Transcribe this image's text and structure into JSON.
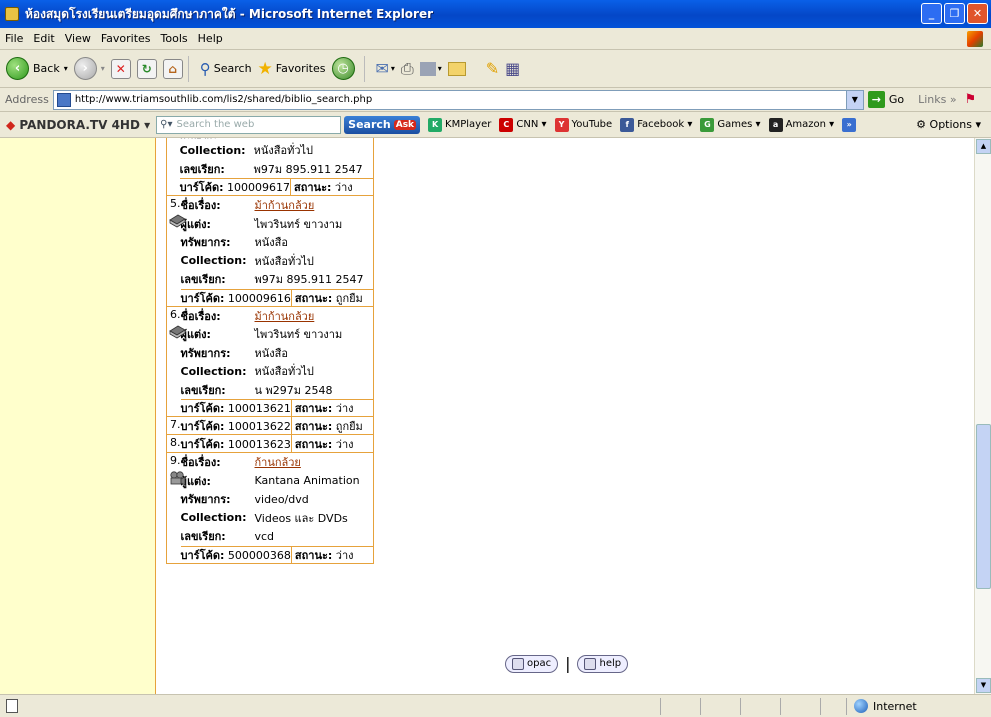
{
  "window": {
    "title": "ห้องสมุดโรงเรียนเตรียมอุดมศึกษาภาคใต้ - Microsoft Internet Explorer",
    "buttons": [
      "_",
      "❐",
      "✕"
    ]
  },
  "menu": [
    "File",
    "Edit",
    "View",
    "Favorites",
    "Tools",
    "Help"
  ],
  "toolbar": {
    "back": "Back",
    "search": "Search",
    "favorites": "Favorites"
  },
  "address": {
    "label": "Address",
    "url": "http://www.triamsouthlib.com/lis2/shared/biblio_search.php",
    "go": "Go",
    "links": "Links »"
  },
  "pandora": {
    "brand": "PANDORA.TV",
    "brand_suffix": "4HD",
    "search_placeholder": "Search the web",
    "search_btn": "Search",
    "bookmarks": [
      "KMPlayer",
      "CNN ▾",
      "YouTube",
      "Facebook ▾",
      "Games ▾",
      "Amazon ▾"
    ],
    "options": "Options ▾"
  },
  "results": {
    "top_partial": {
      "collection_label": "Collection:",
      "collection": "หนังสือทั่วไป",
      "call_label": "เลขเรียก:",
      "call": "พ97ม 895.911 2547",
      "barcode_label": "บาร์โค้ด:",
      "barcode": "100009617",
      "status_label": "สถานะ:",
      "status": "ว่าง"
    },
    "items": [
      {
        "num": "5.",
        "title_label": "ชื่อเรื่อง:",
        "title": "ม้าก้านกล้วย",
        "author_label": "ผู้แต่ง:",
        "author": "ไพวรินทร์ ขาวงาม",
        "type_label": "ทรัพยากร:",
        "type": "หนังสือ",
        "collection_label": "Collection:",
        "collection": "หนังสือทั่วไป",
        "call_label": "เลขเรียก:",
        "call": "พ97ม 895.911 2547",
        "barcode_label": "บาร์โค้ด:",
        "barcode": "100009616",
        "status_label": "สถานะ:",
        "status": "ถูกยืม",
        "icon": "book-icon"
      },
      {
        "num": "6.",
        "title_label": "ชื่อเรื่อง:",
        "title": "ม้าก้านกล้วย",
        "author_label": "ผู้แต่ง:",
        "author": "ไพวรินทร์ ขาวงาม",
        "type_label": "ทรัพยากร:",
        "type": "หนังสือ",
        "collection_label": "Collection:",
        "collection": "หนังสือทั่วไป",
        "call_label": "เลขเรียก:",
        "call": "น พ297ม 2548",
        "barcode_label": "บาร์โค้ด:",
        "barcode": "100013621",
        "status_label": "สถานะ:",
        "status": "ว่าง",
        "icon": "book-icon"
      }
    ],
    "simple": [
      {
        "num": "7.",
        "barcode_label": "บาร์โค้ด:",
        "barcode": "100013622",
        "status_label": "สถานะ:",
        "status": "ถูกยืม"
      },
      {
        "num": "8.",
        "barcode_label": "บาร์โค้ด:",
        "barcode": "100013623",
        "status_label": "สถานะ:",
        "status": "ว่าง"
      }
    ],
    "item9": {
      "num": "9.",
      "title_label": "ชื่อเรื่อง:",
      "title": "ก้านกล้วย",
      "author_label": "ผู้แต่ง:",
      "author": "Kantana Animation",
      "type_label": "ทรัพยากร:",
      "type": "video/dvd",
      "collection_label": "Collection:",
      "collection": "Videos และ DVDs",
      "call_label": "เลขเรียก:",
      "call": "vcd",
      "barcode_label": "บาร์โค้ด:",
      "barcode": "500000368",
      "status_label": "สถานะ:",
      "status": "ว่าง",
      "icon": "video-camera-icon"
    }
  },
  "footer_nav": {
    "opac": "opac",
    "separator": "|",
    "help": "help"
  },
  "status": {
    "zone": "Internet"
  }
}
